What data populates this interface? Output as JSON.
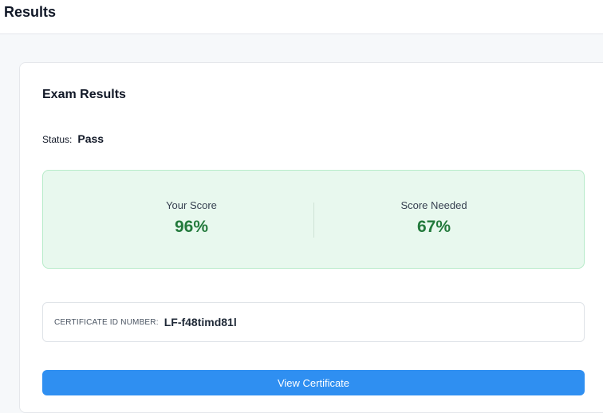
{
  "header": {
    "title": "Results"
  },
  "card": {
    "title": "Exam Results",
    "status_label": "Status:",
    "status_value": "Pass"
  },
  "scores": {
    "your_score_label": "Your Score",
    "your_score_value": "96%",
    "needed_label": "Score Needed",
    "needed_value": "67%"
  },
  "certificate": {
    "label": "CERTIFICATE ID NUMBER:",
    "id": "LF-f48timd81l"
  },
  "actions": {
    "view_certificate": "View Certificate"
  },
  "colors": {
    "accent_button": "#2f8ff1",
    "score_green": "#237a3c",
    "score_panel_bg": "#e8f8ee"
  }
}
